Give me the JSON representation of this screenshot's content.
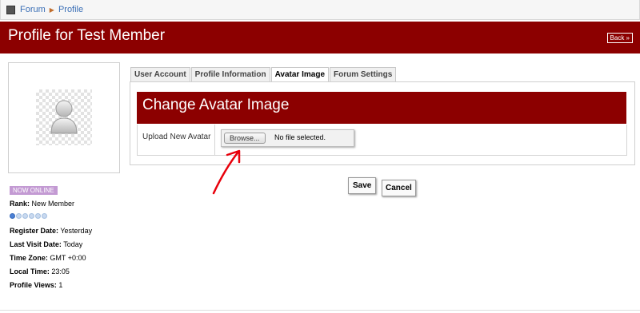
{
  "breadcrumb": {
    "items": [
      "Forum",
      "Profile"
    ]
  },
  "header": {
    "title": "Profile for Test Member",
    "back_label": "Back »"
  },
  "sidebar": {
    "status_badge": "NOW ONLINE",
    "rank_label": "Rank:",
    "rank_value": "New Member",
    "rank_level": {
      "filled": 1,
      "total": 6
    },
    "register_label": "Register Date:",
    "register_value": "Yesterday",
    "last_visit_label": "Last Visit Date:",
    "last_visit_value": "Today",
    "timezone_label": "Time Zone:",
    "timezone_value": "GMT +0:00",
    "local_time_label": "Local Time:",
    "local_time_value": "23:05",
    "views_label": "Profile Views:",
    "views_value": "1"
  },
  "tabs": [
    {
      "label": "User Account"
    },
    {
      "label": "Profile Information"
    },
    {
      "label": "Avatar Image"
    },
    {
      "label": "Forum Settings"
    }
  ],
  "active_tab": "Avatar Image",
  "avatar_panel": {
    "title": "Change Avatar Image",
    "upload_label": "Upload New Avatar",
    "browse_label": "Browse...",
    "file_status": "No file selected."
  },
  "actions": {
    "save_label": "Save",
    "cancel_label": "Cancel"
  },
  "colors": {
    "accent": "#8c0000",
    "link": "#3b6fb6",
    "badge": "#c39ad3",
    "annotation": "#e8000b"
  },
  "icons": {
    "home": "forum-home-icon",
    "separator": "breadcrumb-arrow-icon",
    "avatar": "user-silhouette-icon",
    "annotation": "red-arrow-icon"
  }
}
